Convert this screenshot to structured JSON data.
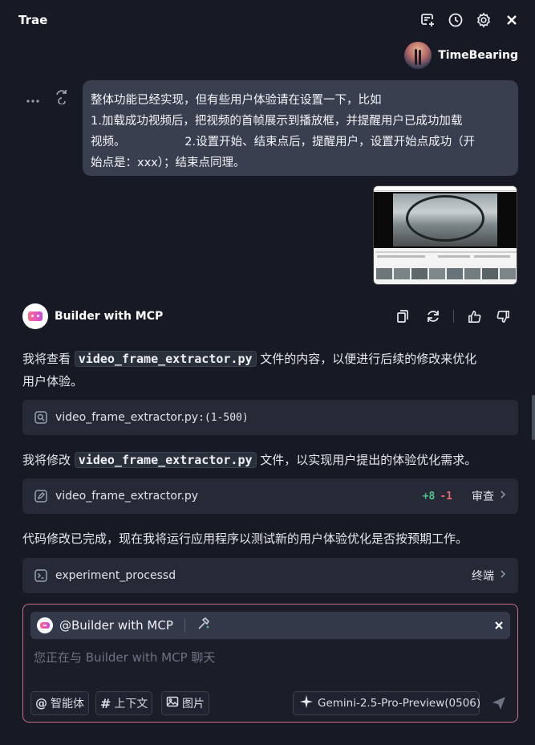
{
  "header": {
    "title": "Trae"
  },
  "user": {
    "name": "TimeBearing"
  },
  "user_message": {
    "line1": "整体功能已经实现，但有些用户体验请在设置一下，比如",
    "line2": "1.加载成功视频后，把视频的首帧展示到播放框，并提醒用户已成功加载",
    "line3": "视频。                2.设置开始、结束点后，提醒用户，设置开始点成功（开",
    "line4": "始点是：xxx）；结束点同理。"
  },
  "bot": {
    "name": "Builder with MCP"
  },
  "messages": {
    "p1_pre": "我将查看 ",
    "p1_code": "video_frame_extractor.py",
    "p1_post": " 文件的内容，以便进行后续的修改来优化",
    "p1_line2": "用户体验。",
    "tool1_label": "video_frame_extractor.py",
    "tool1_range": ":(1-500)",
    "p2_pre": "我将修改 ",
    "p2_code": "video_frame_extractor.py",
    "p2_post": " 文件，以实现用户提出的体验优化需求。",
    "tool2_label": "video_frame_extractor.py",
    "tool2_add": "+8",
    "tool2_del": "-1",
    "tool2_action": "审查",
    "p3": "代码修改已完成，现在我将运行应用程序以测试新的用户体验优化是否按预期工作。",
    "tool3_label": "experiment_processd",
    "tool3_action": "终端"
  },
  "input": {
    "mention": "@Builder with MCP",
    "placeholder": "您正在与 Builder with MCP 聊天",
    "chip_agent": "智能体",
    "chip_context": "上下文",
    "chip_image": "图片",
    "model": "Gemini-2.5-Pro-Preview(0506)"
  },
  "icons": [
    "new-chat-icon",
    "history-icon",
    "settings-icon",
    "close-icon",
    "more-icon",
    "retry-icon",
    "copy-icon",
    "refresh-icon",
    "thumbs-up-icon",
    "thumbs-down-icon",
    "search-icon",
    "edit-icon",
    "terminal-icon",
    "chevron-right-icon",
    "hammer-icon",
    "at-icon",
    "hash-icon",
    "image-icon",
    "sparkle-icon",
    "send-icon"
  ],
  "colors": {
    "background": "#171a25",
    "bubble": "#3a3f50",
    "tool_card": "#262a37",
    "added": "#4fc38a",
    "removed": "#e5656f",
    "input_border": "#c96f8a"
  }
}
